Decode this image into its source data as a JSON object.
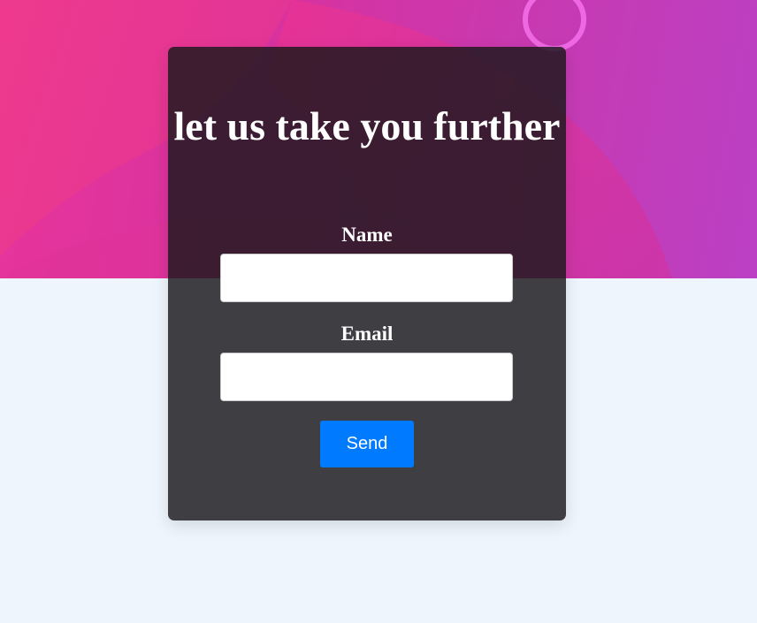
{
  "colors": {
    "hero_start": "#e8359a",
    "hero_end": "#bb40c4",
    "page_background": "#eef5fd",
    "card_background": "#3f4042",
    "button_accent": "#007bff",
    "text": "#ffffff"
  },
  "form": {
    "title": "let us take you further",
    "name_label": "Name",
    "name_value": "",
    "email_label": "Email",
    "email_value": "",
    "submit_label": "Send"
  }
}
